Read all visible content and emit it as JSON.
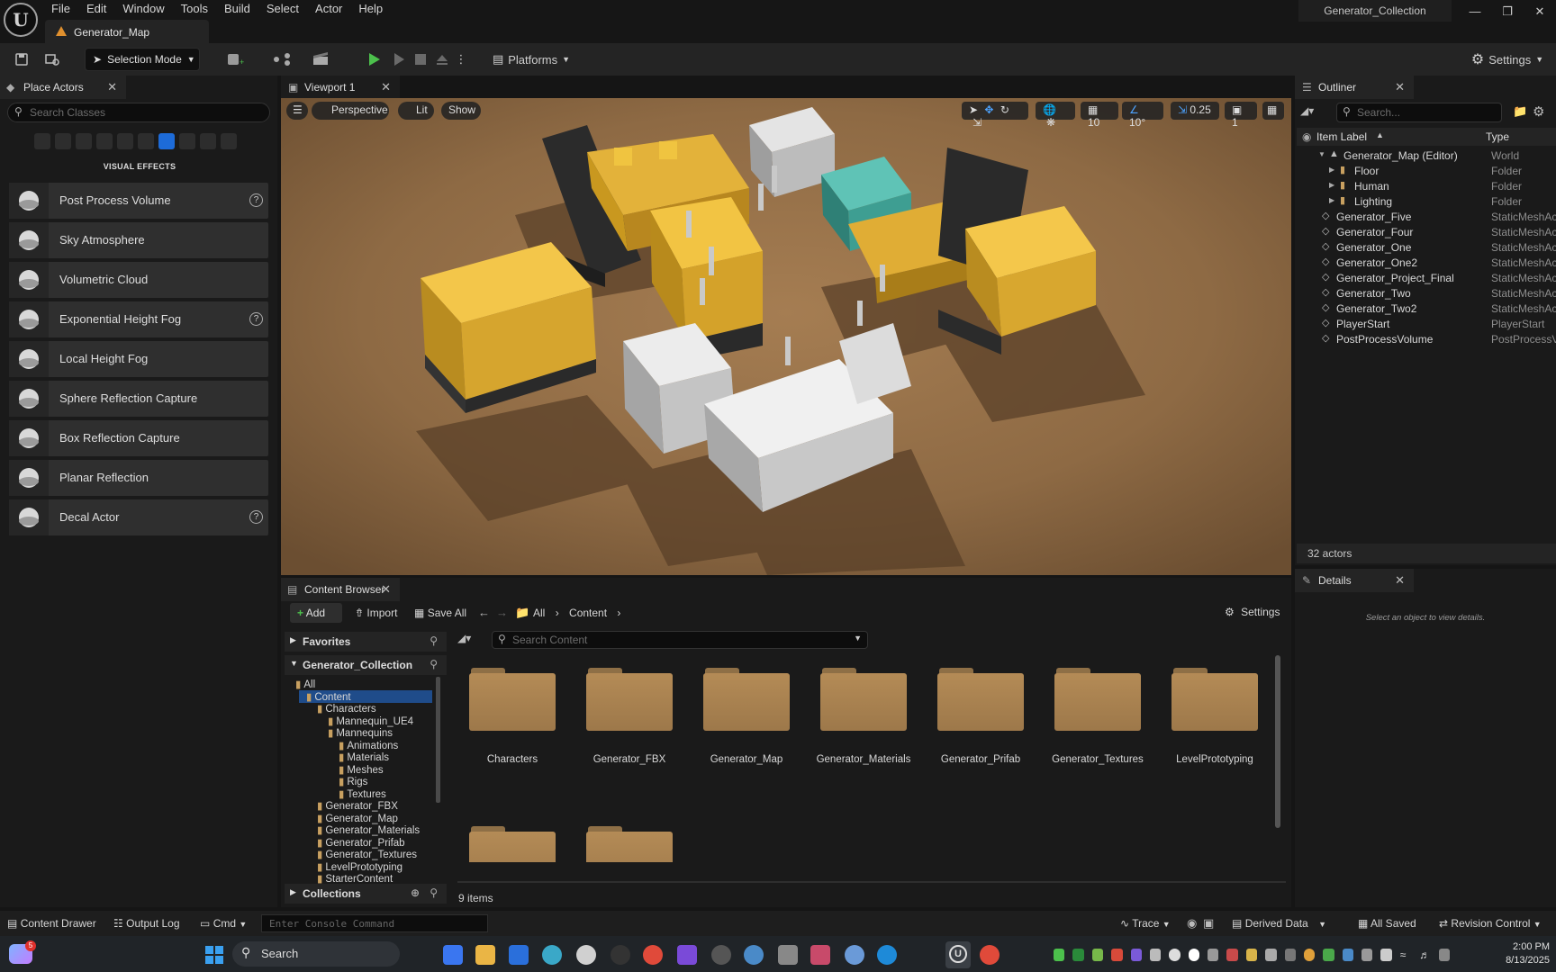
{
  "window": {
    "project": "Generator_Collection",
    "map_tab": "Generator_Map"
  },
  "menu": [
    "File",
    "Edit",
    "Window",
    "Tools",
    "Build",
    "Select",
    "Actor",
    "Help"
  ],
  "toolbar": {
    "selection_mode": "Selection Mode",
    "platforms": "Platforms",
    "settings": "Settings"
  },
  "place_actors": {
    "tab": "Place Actors",
    "search_placeholder": "Search Classes",
    "category": "VISUAL EFFECTS",
    "items": [
      {
        "label": "Post Process Volume",
        "help": true
      },
      {
        "label": "Sky Atmosphere",
        "help": false
      },
      {
        "label": "Volumetric Cloud",
        "help": false
      },
      {
        "label": "Exponential Height Fog",
        "help": true
      },
      {
        "label": "Local Height Fog",
        "help": false
      },
      {
        "label": "Sphere Reflection Capture",
        "help": false
      },
      {
        "label": "Box Reflection Capture",
        "help": false
      },
      {
        "label": "Planar Reflection",
        "help": false
      },
      {
        "label": "Decal Actor",
        "help": true
      }
    ]
  },
  "viewport": {
    "tab": "Viewport 1",
    "perspective": "Perspective",
    "lit": "Lit",
    "show": "Show",
    "grid_snap": "10",
    "rot_snap": "10°",
    "scale_snap": "0.25",
    "camera_speed": "1"
  },
  "outliner": {
    "tab": "Outliner",
    "search_placeholder": "Search...",
    "col_label": "Item Label",
    "col_type": "Type",
    "rows": [
      {
        "label": "Generator_Map (Editor)",
        "type": "World"
      },
      {
        "label": "Floor",
        "type": "Folder"
      },
      {
        "label": "Human",
        "type": "Folder"
      },
      {
        "label": "Lighting",
        "type": "Folder"
      },
      {
        "label": "Generator_Five",
        "type": "StaticMeshAc"
      },
      {
        "label": "Generator_Four",
        "type": "StaticMeshAc"
      },
      {
        "label": "Generator_One",
        "type": "StaticMeshAc"
      },
      {
        "label": "Generator_One2",
        "type": "StaticMeshAc"
      },
      {
        "label": "Generator_Project_Final",
        "type": "StaticMeshAc"
      },
      {
        "label": "Generator_Two",
        "type": "StaticMeshAc"
      },
      {
        "label": "Generator_Two2",
        "type": "StaticMeshAc"
      },
      {
        "label": "PlayerStart",
        "type": "PlayerStart"
      },
      {
        "label": "PostProcessVolume",
        "type": "PostProcessV"
      }
    ],
    "count": "32 actors"
  },
  "details": {
    "tab": "Details",
    "empty": "Select an object to view details."
  },
  "content_browser": {
    "tab": "Content Browser",
    "add": "Add",
    "import": "Import",
    "save_all": "Save All",
    "crumb_all": "All",
    "crumb_content": "Content",
    "settings": "Settings",
    "favorites": "Favorites",
    "collection": "Generator_Collection",
    "collections": "Collections",
    "search_placeholder": "Search Content",
    "tree": [
      {
        "label": "All",
        "depth": 0
      },
      {
        "label": "Content",
        "depth": 1
      },
      {
        "label": "Characters",
        "depth": 2
      },
      {
        "label": "Mannequin_UE4",
        "depth": 3
      },
      {
        "label": "Mannequins",
        "depth": 3
      },
      {
        "label": "Animations",
        "depth": 4
      },
      {
        "label": "Materials",
        "depth": 4
      },
      {
        "label": "Meshes",
        "depth": 4
      },
      {
        "label": "Rigs",
        "depth": 4
      },
      {
        "label": "Textures",
        "depth": 4
      },
      {
        "label": "Generator_FBX",
        "depth": 2
      },
      {
        "label": "Generator_Map",
        "depth": 2
      },
      {
        "label": "Generator_Materials",
        "depth": 2
      },
      {
        "label": "Generator_Prifab",
        "depth": 2
      },
      {
        "label": "Generator_Textures",
        "depth": 2
      },
      {
        "label": "LevelPrototyping",
        "depth": 2
      },
      {
        "label": "StarterContent",
        "depth": 2
      }
    ],
    "folders": [
      "Characters",
      "Generator_FBX",
      "Generator_Map",
      "Generator_Materials",
      "Generator_Prifab",
      "Generator_Textures",
      "LevelPrototyping",
      "",
      ""
    ],
    "item_count": "9 items"
  },
  "statusbar": {
    "content_drawer": "Content Drawer",
    "output_log": "Output Log",
    "cmd": "Cmd",
    "console_placeholder": "Enter Console Command",
    "trace": "Trace",
    "derived_data": "Derived Data",
    "all_saved": "All Saved",
    "revision_control": "Revision Control"
  },
  "taskbar": {
    "search": "Search",
    "time": "2:00 PM",
    "date": "8/13/2025",
    "badge": "5"
  }
}
